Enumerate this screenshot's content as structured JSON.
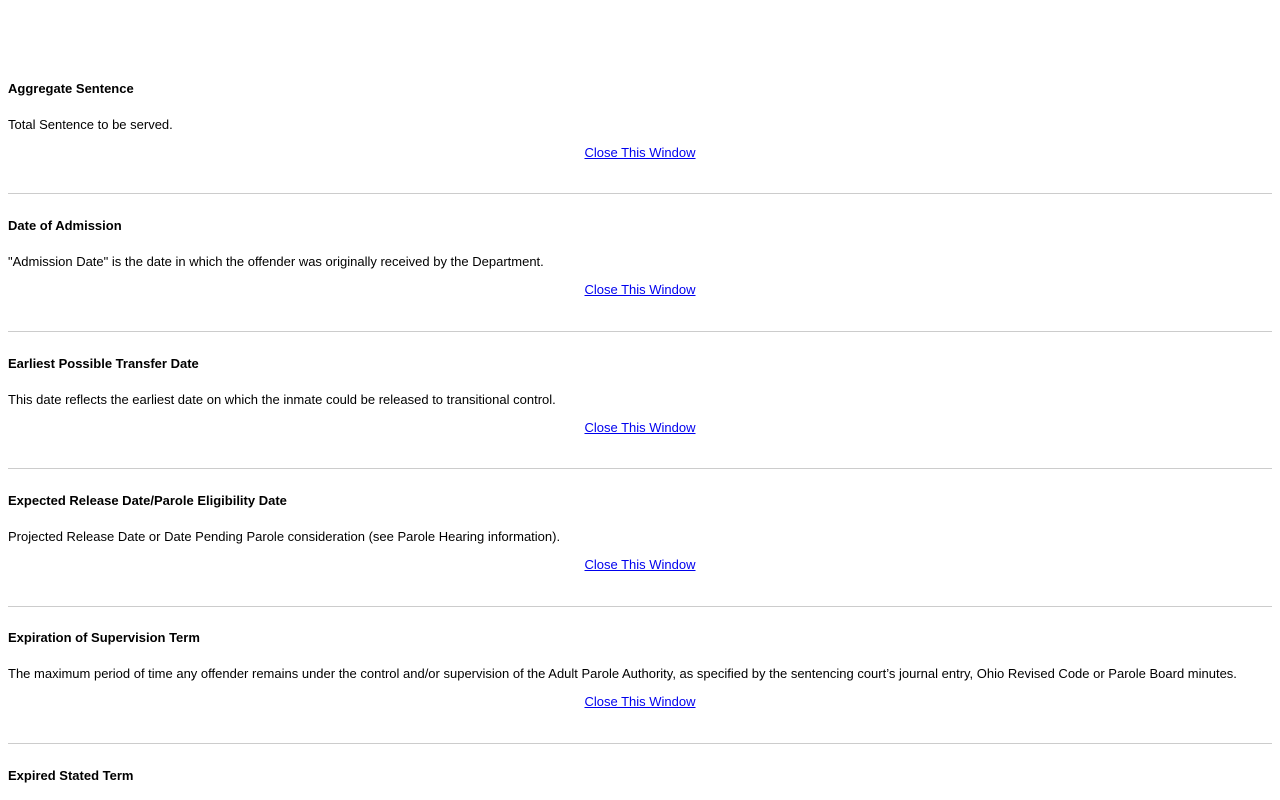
{
  "sections": [
    {
      "title": "Aggregate Sentence",
      "description": "Total Sentence to be served.",
      "close_label": "Close This Window"
    },
    {
      "title": "Date of Admission",
      "description": "\"Admission Date\" is the date in which the offender was originally received by the Department.",
      "close_label": "Close This Window"
    },
    {
      "title": "Earliest Possible Transfer Date",
      "description": "This date reflects the earliest date on which the inmate could be released to transitional control.",
      "close_label": "Close This Window"
    },
    {
      "title": "Expected Release Date/Parole Eligibility Date",
      "description": "Projected Release Date or Date Pending Parole consideration (see Parole Hearing information).",
      "close_label": "Close This Window"
    },
    {
      "title": "Expiration of Supervision Term",
      "description": "The maximum period of time any offender remains under the control and/or supervision of the Adult Parole Authority, as specified by the sentencing court’s journal entry, Ohio Revised Code or Parole Board minutes.",
      "close_label": "Close This Window"
    },
    {
      "title": "Expired Stated Term",
      "description": "",
      "close_label": ""
    }
  ]
}
